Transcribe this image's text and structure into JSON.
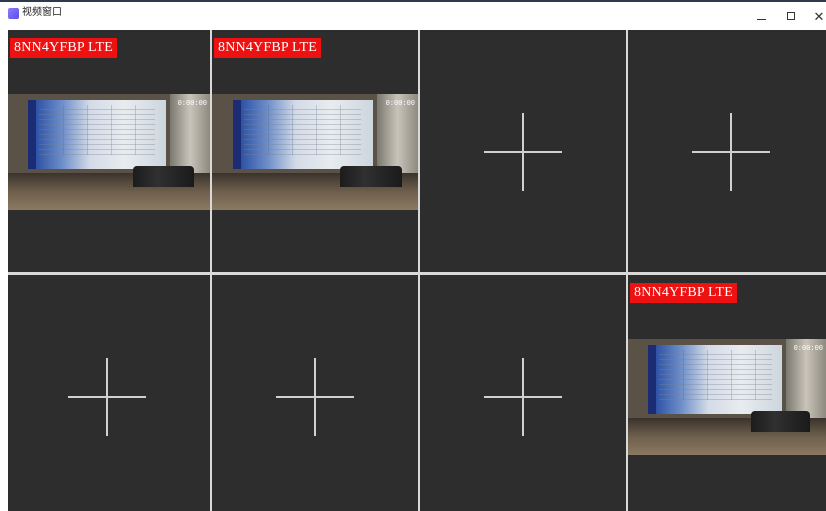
{
  "window": {
    "title": "视频窗口",
    "controls": {
      "minimize_icon": "minimize-icon",
      "maximize_icon": "maximize-icon",
      "close_icon": "close-icon"
    }
  },
  "colors": {
    "cell_background": "#2d2d2d",
    "grid_divider": "#d9d9d9",
    "label_background": "#ee1111",
    "label_text": "#ffffff",
    "placeholder_cross": "#d0d0d0"
  },
  "cells": [
    {
      "status": "streaming",
      "label": "8NN4YFBP LTE",
      "timestamp": "0:00:00"
    },
    {
      "status": "streaming",
      "label": "8NN4YFBP LTE",
      "timestamp": "0:00:00"
    },
    {
      "status": "empty",
      "icon": "add-stream-icon"
    },
    {
      "status": "empty",
      "icon": "add-stream-icon"
    },
    {
      "status": "empty",
      "icon": "add-stream-icon"
    },
    {
      "status": "empty",
      "icon": "add-stream-icon"
    },
    {
      "status": "empty",
      "icon": "add-stream-icon"
    },
    {
      "status": "streaming",
      "label": "8NN4YFBP LTE",
      "timestamp": "0:00:00"
    }
  ]
}
